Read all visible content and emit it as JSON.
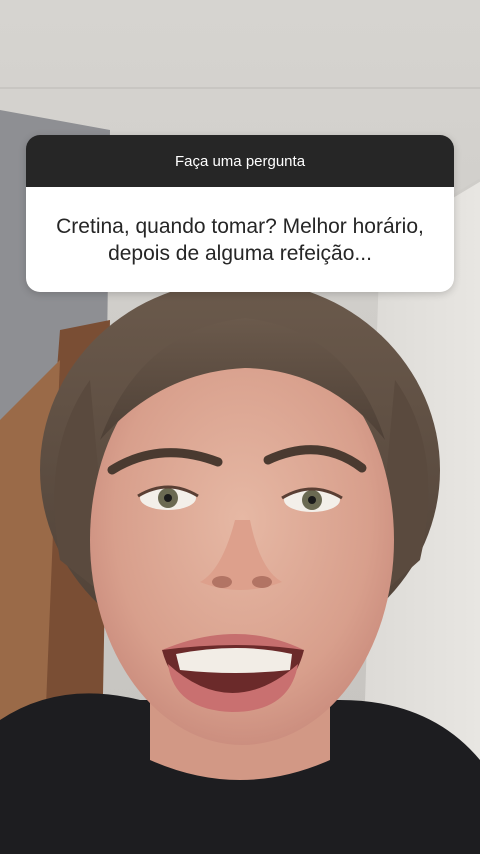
{
  "question_sticker": {
    "header_label": "Faça uma pergunta",
    "question_text": "Cretina, quando tomar? Melhor horário, depois de alguma refeição..."
  },
  "video": {
    "subject": "person-speaking-to-camera"
  },
  "colors": {
    "sticker_header_bg": "#262626",
    "sticker_body_bg": "#ffffff",
    "sticker_text": "#262626"
  }
}
